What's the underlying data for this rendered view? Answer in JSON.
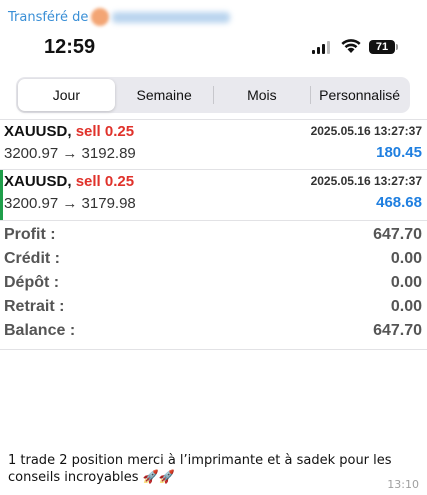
{
  "forwarded": {
    "label": "Transféré de"
  },
  "status_bar": {
    "time": "12:59",
    "battery": "71"
  },
  "tabs": [
    {
      "label": "Jour",
      "active": true
    },
    {
      "label": "Semaine",
      "active": false
    },
    {
      "label": "Mois",
      "active": false
    },
    {
      "label": "Personnalisé",
      "active": false
    }
  ],
  "deals": [
    {
      "symbol": "XAUUSD,",
      "direction": "sell 0.25",
      "date": "2025.05.16 13:27:37",
      "prices": "3200.97 → 3192.89",
      "profit": "180.45"
    },
    {
      "symbol": "XAUUSD,",
      "direction": "sell 0.25",
      "date": "2025.05.16 13:27:37",
      "prices": "3200.97 → 3179.98",
      "profit": "468.68"
    }
  ],
  "summary": [
    {
      "label": "Profit :",
      "value": "647.70"
    },
    {
      "label": "Crédit :",
      "value": "0.00"
    },
    {
      "label": "Dépôt :",
      "value": "0.00"
    },
    {
      "label": "Retrait :",
      "value": "0.00"
    },
    {
      "label": "Balance :",
      "value": "647.70"
    }
  ],
  "message": {
    "text": "1 trade 2 position merci à l’imprimante et à sadek pour les conseils incroyables",
    "time": "13:10"
  },
  "colors": {
    "sell": "#e0322b",
    "profit": "#1f7fe0",
    "link": "#3a8fd6",
    "selected_bar": "#1f9e4a"
  }
}
